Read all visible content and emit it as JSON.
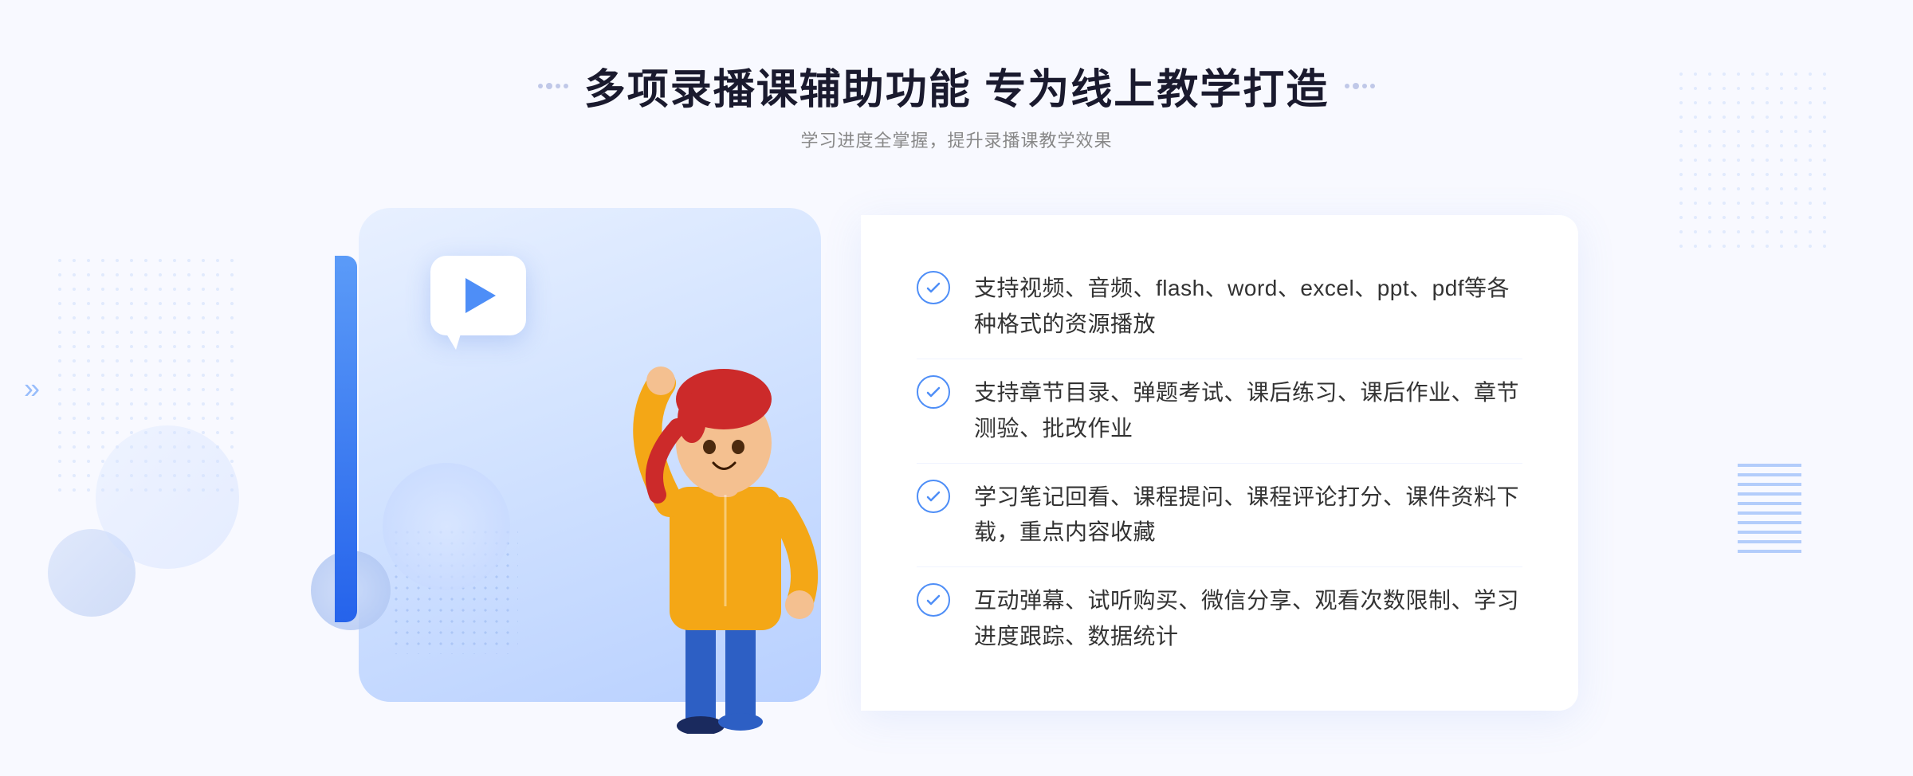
{
  "header": {
    "title": "多项录播课辅助功能 专为线上教学打造",
    "subtitle": "学习进度全掌握，提升录播课教学效果",
    "decorator_left": "decorative-dots-left",
    "decorator_right": "decorative-dots-right"
  },
  "features": [
    {
      "id": 1,
      "text": "支持视频、音频、flash、word、excel、ppt、pdf等各种格式的资源播放"
    },
    {
      "id": 2,
      "text": "支持章节目录、弹题考试、课后练习、课后作业、章节测验、批改作业"
    },
    {
      "id": 3,
      "text": "学习笔记回看、课程提问、课程评论打分、课件资料下载，重点内容收藏"
    },
    {
      "id": 4,
      "text": "互动弹幕、试听购买、微信分享、观看次数限制、学习进度跟踪、数据统计"
    }
  ],
  "colors": {
    "primary_blue": "#4e8ef7",
    "dark_blue": "#2563eb",
    "text_dark": "#1a1a2e",
    "text_gray": "#888888",
    "text_feature": "#333333",
    "bg_light": "#f8f9ff",
    "white": "#ffffff"
  }
}
